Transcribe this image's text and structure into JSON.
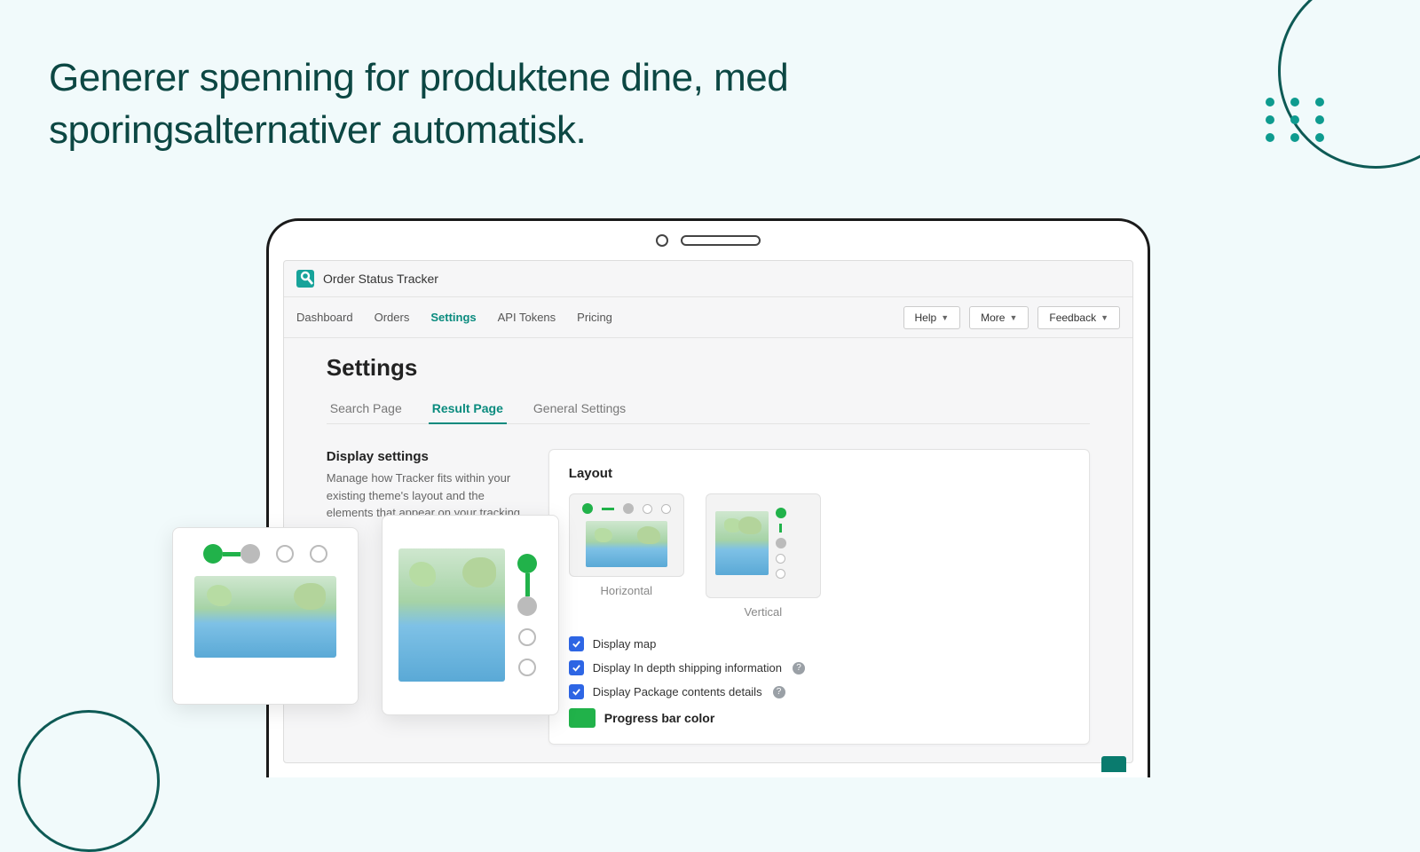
{
  "headline": "Generer spenning for produktene dine, med sporingsalternativer automatisk.",
  "app": {
    "title": "Order Status Tracker",
    "nav": {
      "items": [
        "Dashboard",
        "Orders",
        "Settings",
        "API Tokens",
        "Pricing"
      ],
      "active_index": 2,
      "buttons": {
        "help": "Help",
        "more": "More",
        "feedback": "Feedback"
      }
    },
    "page": {
      "title": "Settings",
      "subtabs": [
        "Search Page",
        "Result Page",
        "General Settings"
      ],
      "subtab_active_index": 1
    },
    "section": {
      "title": "Display settings",
      "desc": "Manage how Tracker fits within your existing theme's layout and the elements that appear on your tracking page."
    },
    "panel": {
      "title": "Layout",
      "options": {
        "horizontal": "Horizontal",
        "vertical": "Vertical"
      },
      "checks": {
        "display_map": "Display map",
        "display_shipping": "Display In depth shipping information",
        "display_package": "Display Package contents details"
      },
      "color_label": "Progress bar color",
      "color_value": "#21b24a"
    }
  }
}
